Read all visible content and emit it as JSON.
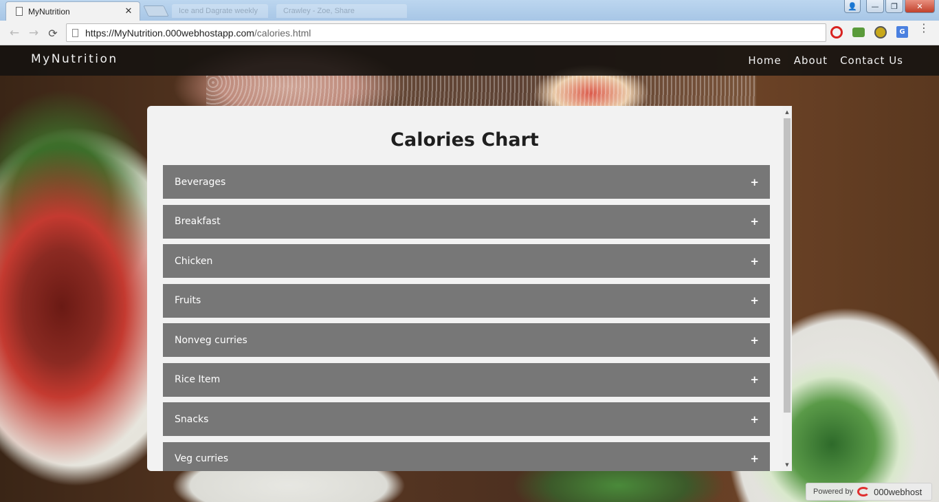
{
  "browser": {
    "active_tab_title": "MyNutrition",
    "tab_close": "✕",
    "ghost_tabs": [
      "Ice and Dagrate weekly",
      "Crawley - Zoe, Share"
    ],
    "url_host": "https://MyNutrition.000webhostapp.com",
    "url_path": "/calories.html",
    "nav": {
      "back": "←",
      "forward": "→",
      "reload": "⟳"
    },
    "window_controls": {
      "minimize": "—",
      "maximize": "❐",
      "close": "✕",
      "user": "👤"
    },
    "extensions": {
      "translate": "G"
    },
    "menu": "⋮"
  },
  "site": {
    "brand": "MyNutrition",
    "nav_links": [
      "Home",
      "About",
      "Contact Us"
    ]
  },
  "panel": {
    "title": "Calories Chart",
    "categories": [
      {
        "label": "Beverages",
        "toggle": "+"
      },
      {
        "label": "Breakfast",
        "toggle": "+"
      },
      {
        "label": "Chicken",
        "toggle": "+"
      },
      {
        "label": "Fruits",
        "toggle": "+"
      },
      {
        "label": "Nonveg curries",
        "toggle": "+"
      },
      {
        "label": "Rice Item",
        "toggle": "+"
      },
      {
        "label": "Snacks",
        "toggle": "+"
      },
      {
        "label": "Veg curries",
        "toggle": "+"
      }
    ],
    "scroll": {
      "up": "▲",
      "down": "▼"
    }
  },
  "footer_badge": {
    "powered_by": "Powered by",
    "host": "000webhost"
  }
}
